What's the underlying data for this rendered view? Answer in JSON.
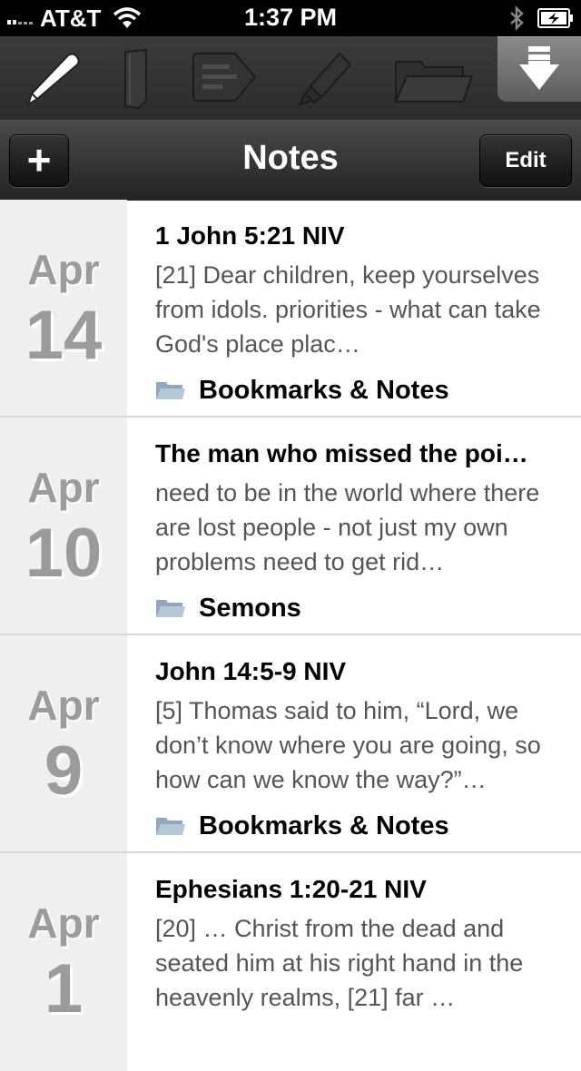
{
  "status_bar": {
    "carrier": "AT&T",
    "time": "1:37 PM"
  },
  "toolbar": {
    "tools": [
      {
        "name": "pencil-icon"
      },
      {
        "name": "bookmark-icon"
      },
      {
        "name": "note-tag-icon"
      },
      {
        "name": "highlighter-icon"
      },
      {
        "name": "folder-icon"
      },
      {
        "name": "download-icon",
        "active": true
      }
    ]
  },
  "navbar": {
    "add_label": "+",
    "title": "Notes",
    "edit_label": "Edit"
  },
  "notes": [
    {
      "month": "Apr",
      "day": "14",
      "title": "1 John 5:21 NIV",
      "body": "[21] Dear children, keep yourselves from idols.  priorities - what can take God's place plac…",
      "folder": "Bookmarks & Notes"
    },
    {
      "month": "Apr",
      "day": "10",
      "title": "The man who missed the poi…",
      "body": "need to be in the world where there are lost people - not just my own problems  need to get rid…",
      "folder": "Semons"
    },
    {
      "month": "Apr",
      "day": "9",
      "title": "John 14:5-9 NIV",
      "body": "[5] Thomas said to him, “Lord, we don’t know where you are going, so how can we know the way?”…",
      "folder": "Bookmarks & Notes"
    },
    {
      "month": "Apr",
      "day": "1",
      "title": "Ephesians 1:20-21 NIV",
      "body": "[20] … Christ from the dead and seated him at his right hand in the heavenly realms, [21] far …",
      "folder": ""
    }
  ]
}
